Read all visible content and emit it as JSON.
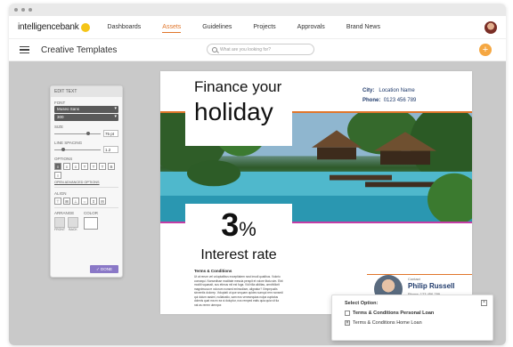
{
  "brand": {
    "name": "intelligencebank",
    "accent": "#e0762b",
    "logo_dot": "#f5c518"
  },
  "nav": {
    "items": [
      {
        "label": "Dashboards",
        "active": false
      },
      {
        "label": "Assets",
        "active": true
      },
      {
        "label": "Guidelines",
        "active": false
      },
      {
        "label": "Projects",
        "active": false
      },
      {
        "label": "Approvals",
        "active": false
      },
      {
        "label": "Brand News",
        "active": false
      }
    ]
  },
  "subbar": {
    "title": "Creative Templates",
    "search_placeholder": "What are you looking for?",
    "add_icon": "plus-icon"
  },
  "edit_panel": {
    "title": "EDIT TEXT",
    "font_label": "FONT",
    "font_value": "Museo Sans",
    "weight_value": "300",
    "size_label": "SIZE",
    "size_value": "75 pt",
    "line_spacing_label": "LINE SPACING",
    "line_spacing_value": "1.2",
    "options_label": "OPTIONS",
    "advanced_link": "OPEN ADVANCED OPTIONS",
    "align_label": "ALIGN",
    "arrange_label": "ARRANGE",
    "front_label": "FRONT",
    "back_label": "BACK",
    "color_label": "COLOR",
    "done_label": "DONE"
  },
  "document": {
    "headline_line1": "Finance your",
    "headline_line2": "holiday",
    "city_label": "City:",
    "city_value": "Location Name",
    "phone_label": "Phone:",
    "phone_value": "0123 456 789",
    "rate_number": "3",
    "rate_symbol": "%",
    "rate_label": "Interest rate",
    "terms_heading": "Terms & Conditions",
    "terms_body": "Ut at rerum vel voluptatibus exceptiatem nost imodi quatibus. Volorio consequi. Nonsedisse moditate mescia perspit et volore litatu sim. Ebit moditi squassit, sus etimus mil est fuga. Vid hilla aliditas, omnihillorit magnimusa re volorum nonsed enimodiam, alignatur? Ximpepudis sinventis dolorep. Voluptati ut que sequam quides sumqui rem nonsedi qui dolum assimi, nullatustio, sam eos venesequias nulpa cuptatus dolenis quat ma ex ea si doluptur, nos remped eatis quia quia vit tia nat as rerem utempor."
  },
  "contact": {
    "label": "Contact",
    "name": "Philip Russell",
    "phone": "Phone: 123 456 789"
  },
  "popup": {
    "title": "Select Option:",
    "options": [
      {
        "label": "Terms & Conditions Personal Loan",
        "checked": false
      },
      {
        "label": "Terms & Conditions Home Loan",
        "checked": true
      }
    ]
  }
}
